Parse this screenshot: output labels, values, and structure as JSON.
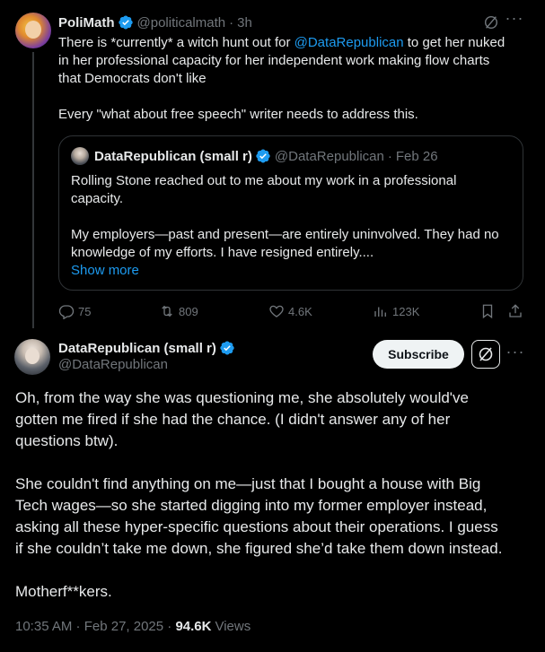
{
  "parent_tweet": {
    "author_name": "PoliMath",
    "author_handle": "@politicalmath",
    "time": "3h",
    "text_lines": [
      {
        "pre": "There is *currently* a witch hunt out for ",
        "mention": "@DataRepublican",
        "post": " to get her nuked"
      },
      {
        "pre": "in her professional capacity for her independent work making flow charts",
        "mention": "",
        "post": ""
      },
      {
        "pre": "that Democrats don't like",
        "mention": "",
        "post": ""
      }
    ],
    "text_line_4": "Every \"what about free speech\" writer needs to address this.",
    "quote": {
      "author_name": "DataRepublican (small r)",
      "author_handle": "@DataRepublican",
      "date": "Feb 26",
      "line1": "Rolling Stone reached out to me about my work in a professional",
      "line2": "capacity.",
      "line3": "My employers—past and present—are entirely uninvolved. They had no",
      "line4": "knowledge of my efforts. I have resigned entirely....",
      "show_more": "Show more"
    },
    "stats": {
      "replies": "75",
      "reposts": "809",
      "likes": "4.6K",
      "views": "123K"
    }
  },
  "main_tweet": {
    "author_name": "DataRepublican (small r)",
    "author_handle": "@DataRepublican",
    "subscribe_label": "Subscribe",
    "paragraph1": [
      "Oh, from the way she was questioning me, she absolutely would've",
      "gotten me fired if she had the chance. (I didn't answer any of her",
      "questions btw)."
    ],
    "paragraph2": [
      "She couldn't find anything on me—just that I bought a house with Big",
      "Tech wages—so she started digging into my former employer instead,",
      "asking all these hyper-specific questions about their operations. I guess",
      "if she couldn’t take me down, she figured she’d take them down instead."
    ],
    "paragraph3": "Motherf**kers.",
    "timestamp": "10:35 AM · Feb 27, 2025 · ",
    "view_count": "94.6K",
    "views_label": "Views"
  },
  "colors": {
    "background": "#000000",
    "accent": "#1d9bf0",
    "muted": "#71767b",
    "text": "#e7e9ea",
    "border": "#2f3336"
  },
  "icons": [
    "verified-badge-icon",
    "grok-icon",
    "more-icon",
    "reply-icon",
    "repost-icon",
    "like-icon",
    "views-icon",
    "bookmark-icon",
    "share-icon"
  ]
}
